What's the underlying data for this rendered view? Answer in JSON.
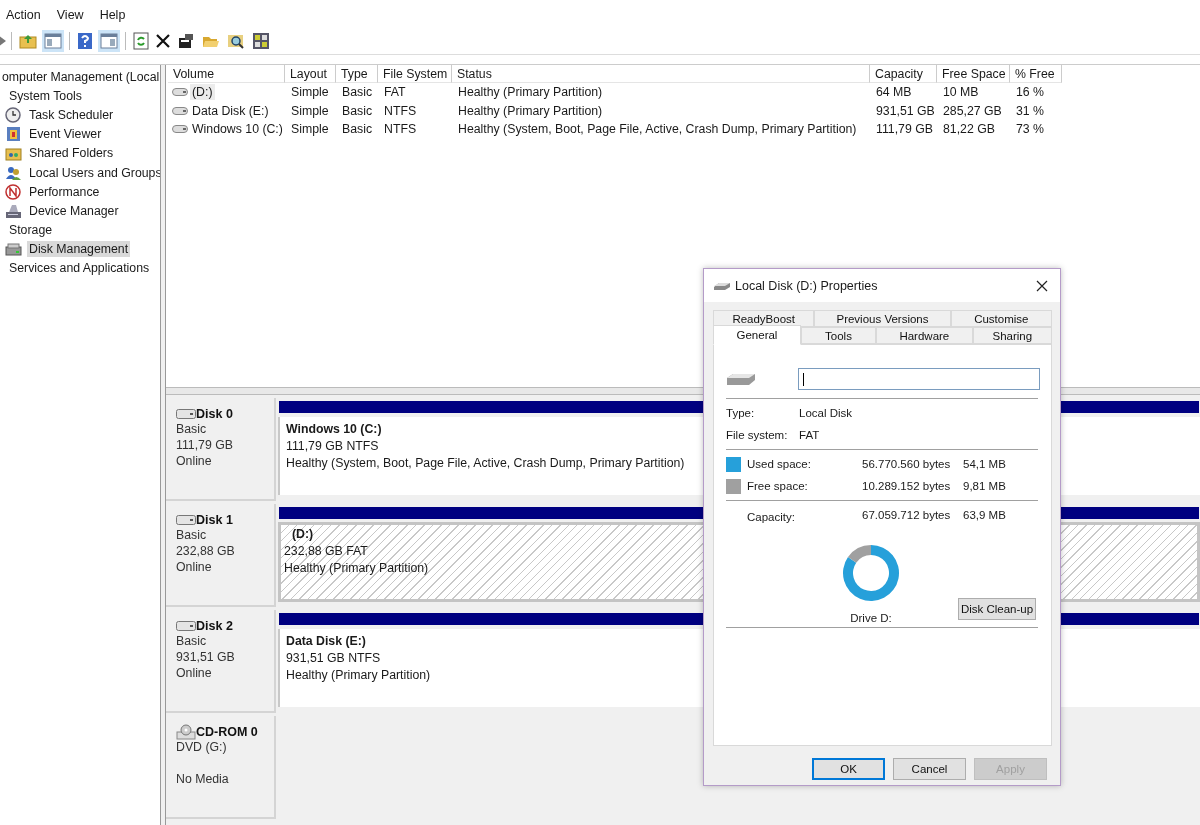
{
  "menu": [
    "Action",
    "View",
    "Help"
  ],
  "tree": {
    "label": "omputer Management (Local",
    "selected": false,
    "children": [
      {
        "label": "System Tools",
        "selected": false,
        "children": [
          {
            "label": "Task Scheduler",
            "selected": false
          },
          {
            "label": "Event Viewer",
            "selected": false
          },
          {
            "label": "Shared Folders",
            "selected": false
          },
          {
            "label": "Local Users and Groups",
            "selected": false
          },
          {
            "label": "Performance",
            "selected": false
          },
          {
            "label": "Device Manager",
            "selected": false
          }
        ]
      },
      {
        "label": "Storage",
        "selected": false,
        "children": [
          {
            "label": "Disk Management",
            "selected": true
          }
        ]
      },
      {
        "label": "Services and Applications",
        "selected": false
      }
    ]
  },
  "volumes": {
    "columns": [
      "Volume",
      "Layout",
      "Type",
      "File System",
      "Status",
      "Capacity",
      "Free Space",
      "% Free"
    ],
    "rows": [
      {
        "selected": true,
        "cells": [
          "(D:)",
          "Simple",
          "Basic",
          "FAT",
          "Healthy (Primary Partition)",
          "64 MB",
          "10 MB",
          "16 %"
        ]
      },
      {
        "selected": false,
        "cells": [
          "Data Disk (E:)",
          "Simple",
          "Basic",
          "NTFS",
          "Healthy (Primary Partition)",
          "931,51 GB",
          "285,27 GB",
          "31 %"
        ]
      },
      {
        "selected": false,
        "cells": [
          "Windows 10 (C:)",
          "Simple",
          "Basic",
          "NTFS",
          "Healthy (System, Boot, Page File, Active, Crash Dump, Primary Partition)",
          "111,79 GB",
          "81,22 GB",
          "73 %"
        ]
      }
    ]
  },
  "disks": [
    {
      "kind": "disk",
      "name": "Disk 0",
      "lines": [
        "Basic",
        "111,79 GB",
        "Online"
      ],
      "partition": {
        "title": "Windows 10  (C:)",
        "size": "111,79 GB NTFS",
        "status": "Healthy (System, Boot, Page File, Active, Crash Dump, Primary Partition)",
        "selected": false
      }
    },
    {
      "kind": "disk",
      "name": "Disk 1",
      "lines": [
        "Basic",
        "232,88 GB",
        "Online"
      ],
      "partition": {
        "title": "(D:)",
        "size": "232,88 GB FAT",
        "status": "Healthy (Primary Partition)",
        "selected": true
      }
    },
    {
      "kind": "disk",
      "name": "Disk 2",
      "lines": [
        "Basic",
        "931,51 GB",
        "Online"
      ],
      "partition": {
        "title": "Data Disk  (E:)",
        "size": "931,51 GB NTFS",
        "status": "Healthy (Primary Partition)",
        "selected": false
      }
    },
    {
      "kind": "cdrom",
      "name": "CD-ROM 0",
      "lines": [
        "DVD (G:)",
        "No Media"
      ]
    }
  ],
  "dialog": {
    "title": "Local Disk (D:) Properties",
    "tabs_back": [
      {
        "label": "ReadyBoost",
        "selected": false
      },
      {
        "label": "Previous Versions",
        "selected": false
      },
      {
        "label": "Customise",
        "selected": false
      }
    ],
    "tabs_front": [
      {
        "label": "General",
        "selected": true
      },
      {
        "label": "Tools",
        "selected": false
      },
      {
        "label": "Hardware",
        "selected": false
      },
      {
        "label": "Sharing",
        "selected": false
      }
    ],
    "info": [
      {
        "label": "Type:",
        "value": "Local Disk"
      },
      {
        "label": "File system:",
        "value": "FAT"
      }
    ],
    "space": [
      {
        "label": "Used space:",
        "bytes": "56.770.560 bytes",
        "size": "54,1 MB",
        "color": "#26a0da"
      },
      {
        "label": "Free space:",
        "bytes": "10.289.152 bytes",
        "size": "9,81 MB",
        "color": "#a0a0a0"
      }
    ],
    "capacity": {
      "label": "Capacity:",
      "bytes": "67.059.712 bytes",
      "size": "63,9 MB"
    },
    "chart_data": {
      "type": "donut",
      "title": "Drive D:",
      "values": [
        84.66,
        15.34
      ]
    },
    "cleanup_button": "Disk Clean-up",
    "buttons": [
      {
        "label": "OK",
        "disabled": false,
        "default": true
      },
      {
        "label": "Cancel",
        "disabled": false,
        "default": false
      },
      {
        "label": "Apply",
        "disabled": true,
        "default": false
      }
    ]
  }
}
